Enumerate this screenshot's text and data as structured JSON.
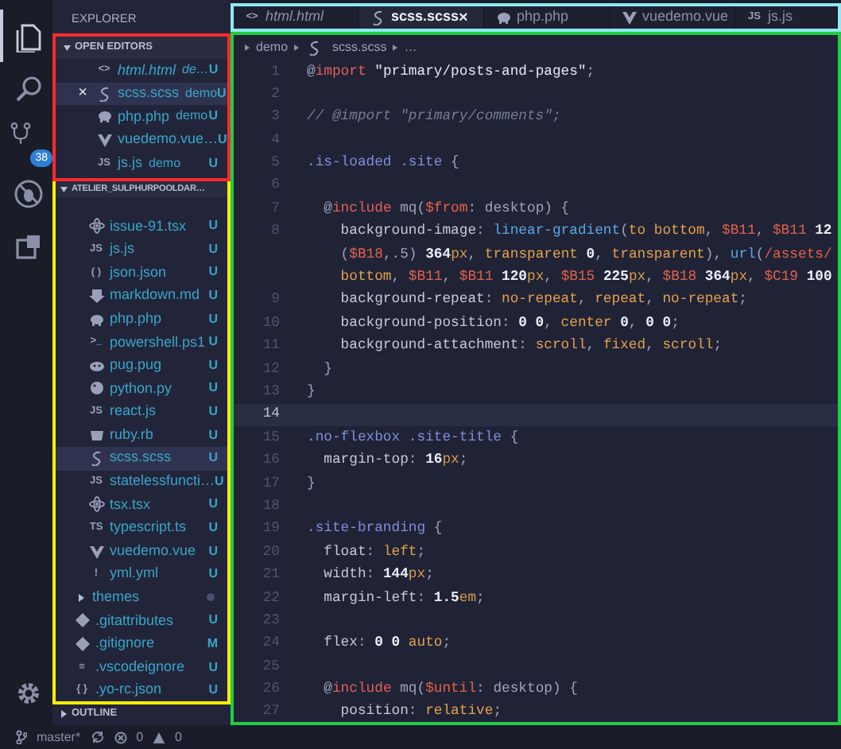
{
  "activity_bar": {
    "items": [
      {
        "kind": "files",
        "selected": true
      },
      {
        "kind": "search",
        "selected": false
      },
      {
        "kind": "source-control",
        "selected": false,
        "badge": "38"
      },
      {
        "kind": "debug",
        "selected": false
      },
      {
        "kind": "extensions",
        "selected": false
      }
    ],
    "bottom": {
      "kind": "settings"
    }
  },
  "sidebar": {
    "title": "EXPLORER",
    "open_editors": {
      "title": "OPEN EDITORS",
      "expanded": true,
      "items": [
        {
          "name": "html.html",
          "description": "de…",
          "kind": "text-icon",
          "glyph": "<>",
          "preview": true,
          "selected": false,
          "status": "U"
        },
        {
          "name": "scss.scss",
          "description": "demo",
          "kind": "scss",
          "preview": false,
          "selected": true,
          "close": "×",
          "status": "U"
        },
        {
          "name": "php.php",
          "description": "demo",
          "kind": "php",
          "preview": false,
          "selected": false,
          "status": "U"
        },
        {
          "name": "vuedemo.vue…",
          "kind": "vue",
          "preview": false,
          "selected": false,
          "status": "U"
        },
        {
          "name": "js.js",
          "description": "demo",
          "kind": "text-icon",
          "glyph": "JS",
          "preview": false,
          "selected": false,
          "status": "U"
        }
      ]
    },
    "project": {
      "title": "ATELIER_SULPHURPOOLDAR…",
      "expanded": true,
      "nested_files": [
        {
          "name": "issue-91.tsx",
          "kind": "tsx",
          "selected": false,
          "status": "U"
        },
        {
          "name": "js.js",
          "kind": "text-icon",
          "glyph": "JS",
          "selected": false,
          "status": "U"
        },
        {
          "name": "json.json",
          "kind": "text-icon",
          "glyph": "( )",
          "selected": false,
          "status": "U"
        },
        {
          "name": "markdown.md",
          "kind": "markdown",
          "selected": false,
          "status": "U"
        },
        {
          "name": "php.php",
          "kind": "php",
          "selected": false,
          "status": "U"
        },
        {
          "name": "powershell.ps1",
          "kind": "text-icon",
          "glyph": ">_",
          "selected": false,
          "status": "U"
        },
        {
          "name": "pug.pug",
          "kind": "pug",
          "selected": false,
          "status": "U"
        },
        {
          "name": "python.py",
          "kind": "python",
          "selected": false,
          "status": "U"
        },
        {
          "name": "react.js",
          "kind": "text-icon",
          "glyph": "JS",
          "selected": false,
          "status": "U"
        },
        {
          "name": "ruby.rb",
          "kind": "ruby",
          "selected": false,
          "status": "U"
        },
        {
          "name": "scss.scss",
          "kind": "scss",
          "selected": true,
          "status": "U"
        },
        {
          "name": "statelessfuncti…",
          "kind": "text-icon",
          "glyph": "JS",
          "selected": false,
          "status": "U"
        },
        {
          "name": "tsx.tsx",
          "kind": "tsx",
          "selected": false,
          "status": "U"
        },
        {
          "name": "typescript.ts",
          "kind": "text-icon",
          "glyph": "TS",
          "selected": false,
          "status": "U"
        },
        {
          "name": "vuedemo.vue",
          "kind": "vue",
          "selected": false,
          "status": "U"
        },
        {
          "name": "yml.yml",
          "kind": "text-icon",
          "glyph": "!",
          "selected": false,
          "status": "U"
        }
      ],
      "root_items": [
        {
          "kind": "folder",
          "name": "themes",
          "expanded": false,
          "dot": true,
          "selected": false
        },
        {
          "kind": "git",
          "name": ".gitattributes",
          "selected": false,
          "status": "U"
        },
        {
          "kind": "git",
          "name": ".gitignore",
          "selected": false,
          "status": "M"
        },
        {
          "kind": "text-icon",
          "glyph": "≡",
          "name": ".vscodeignore",
          "selected": false,
          "status": "U"
        },
        {
          "kind": "text-icon",
          "glyph": "{ }",
          "name": ".yo-rc.json",
          "selected": false,
          "status": "U"
        }
      ]
    },
    "outline": {
      "title": "OUTLINE",
      "expanded": false
    }
  },
  "tabs": [
    {
      "label": "html.html",
      "kind": "text-icon",
      "glyph": "<>",
      "preview": true,
      "selected": false
    },
    {
      "label": "scss.scss",
      "kind": "scss",
      "preview": false,
      "selected": true,
      "close": "×"
    },
    {
      "label": "php.php",
      "kind": "php",
      "preview": false,
      "selected": false
    },
    {
      "label": "vuedemo.vue",
      "kind": "vue",
      "preview": false,
      "selected": false
    },
    {
      "label": "js.js",
      "kind": "text-icon",
      "glyph": "JS",
      "preview": false,
      "selected": false
    }
  ],
  "editor": {
    "breadcrumbs": [
      {
        "label": "demo",
        "kind": "folder"
      },
      {
        "label": "scss.scss",
        "kind": "scss"
      },
      {
        "label": "…",
        "kind": "more"
      }
    ],
    "lines": [
      {
        "number": "1",
        "current": false,
        "tokens": [
          {
            "kind": "p",
            "text": "@"
          },
          {
            "kind": "kw",
            "text": "import"
          },
          {
            "kind": "str",
            "text": " \"primary/posts-and-pages\""
          },
          {
            "kind": "p",
            "text": ";"
          }
        ]
      },
      {
        "number": "2",
        "current": false
      },
      {
        "number": "3",
        "current": false,
        "tokens": [
          {
            "kind": "cm",
            "text": "// @import \"primary/comments\";"
          }
        ]
      },
      {
        "number": "4",
        "current": false
      },
      {
        "number": "5",
        "current": false,
        "tokens": [
          {
            "kind": "sel",
            "text": ".is-loaded .site"
          },
          {
            "kind": "p",
            "text": " {"
          }
        ]
      },
      {
        "number": "6",
        "current": false
      },
      {
        "number": "7",
        "current": false,
        "tokens": [
          {
            "kind": "p",
            "text": "  @"
          },
          {
            "kind": "kw",
            "text": "include"
          },
          {
            "kind": "p",
            "text": " mq("
          },
          {
            "kind": "var",
            "text": "$from"
          },
          {
            "kind": "p",
            "text": ": desktop) {"
          }
        ]
      },
      {
        "number": "8",
        "current": false,
        "tokens": [
          {
            "kind": "prop",
            "text": "    background-image"
          },
          {
            "kind": "p",
            "text": ": "
          },
          {
            "kind": "fn",
            "text": "linear-gradient"
          },
          {
            "kind": "p",
            "text": "("
          },
          {
            "kind": "val",
            "text": "to bottom"
          },
          {
            "kind": "p",
            "text": ", "
          },
          {
            "kind": "var",
            "text": "$B11"
          },
          {
            "kind": "p",
            "text": ", "
          },
          {
            "kind": "var",
            "text": "$B11"
          },
          {
            "kind": "num",
            "text": " 12"
          }
        ]
      },
      {
        "current": false,
        "tokens": [
          {
            "kind": "p",
            "text": "    ("
          },
          {
            "kind": "var",
            "text": "$B18"
          },
          {
            "kind": "p",
            "text": ",.5) "
          },
          {
            "kind": "num",
            "text": "364"
          },
          {
            "kind": "unit",
            "text": "px"
          },
          {
            "kind": "p",
            "text": ", "
          },
          {
            "kind": "val",
            "text": "transparent"
          },
          {
            "kind": "num",
            "text": " 0"
          },
          {
            "kind": "p",
            "text": ", "
          },
          {
            "kind": "val",
            "text": "transparent"
          },
          {
            "kind": "p",
            "text": "), "
          },
          {
            "kind": "fn",
            "text": "url"
          },
          {
            "kind": "p",
            "text": "("
          },
          {
            "kind": "var",
            "text": "/assets/"
          }
        ]
      },
      {
        "current": false,
        "tokens": [
          {
            "kind": "val",
            "text": "    bottom"
          },
          {
            "kind": "p",
            "text": ", "
          },
          {
            "kind": "var",
            "text": "$B11"
          },
          {
            "kind": "p",
            "text": ", "
          },
          {
            "kind": "var",
            "text": "$B11"
          },
          {
            "kind": "num",
            "text": " 120"
          },
          {
            "kind": "unit",
            "text": "px"
          },
          {
            "kind": "p",
            "text": ", "
          },
          {
            "kind": "var",
            "text": "$B15"
          },
          {
            "kind": "num",
            "text": " 225"
          },
          {
            "kind": "unit",
            "text": "px"
          },
          {
            "kind": "p",
            "text": ", "
          },
          {
            "kind": "var",
            "text": "$B18"
          },
          {
            "kind": "num",
            "text": " 364"
          },
          {
            "kind": "unit",
            "text": "px"
          },
          {
            "kind": "p",
            "text": ", "
          },
          {
            "kind": "var",
            "text": "$C19"
          },
          {
            "kind": "num",
            "text": " 100"
          }
        ]
      },
      {
        "number": "9",
        "current": false,
        "tokens": [
          {
            "kind": "prop",
            "text": "    background-repeat"
          },
          {
            "kind": "p",
            "text": ": "
          },
          {
            "kind": "val",
            "text": "no-repeat"
          },
          {
            "kind": "p",
            "text": ", "
          },
          {
            "kind": "val",
            "text": "repeat"
          },
          {
            "kind": "p",
            "text": ", "
          },
          {
            "kind": "val",
            "text": "no-repeat"
          },
          {
            "kind": "p",
            "text": ";"
          }
        ]
      },
      {
        "number": "10",
        "current": false,
        "tokens": [
          {
            "kind": "prop",
            "text": "    background-position"
          },
          {
            "kind": "p",
            "text": ": "
          },
          {
            "kind": "num",
            "text": "0 0"
          },
          {
            "kind": "p",
            "text": ", "
          },
          {
            "kind": "val",
            "text": "center"
          },
          {
            "kind": "num",
            "text": " 0"
          },
          {
            "kind": "p",
            "text": ", "
          },
          {
            "kind": "num",
            "text": "0 0"
          },
          {
            "kind": "p",
            "text": ";"
          }
        ]
      },
      {
        "number": "11",
        "current": false,
        "tokens": [
          {
            "kind": "prop",
            "text": "    background-attachment"
          },
          {
            "kind": "p",
            "text": ": "
          },
          {
            "kind": "val",
            "text": "scroll"
          },
          {
            "kind": "p",
            "text": ", "
          },
          {
            "kind": "val",
            "text": "fixed"
          },
          {
            "kind": "p",
            "text": ", "
          },
          {
            "kind": "val",
            "text": "scroll"
          },
          {
            "kind": "p",
            "text": ";"
          }
        ]
      },
      {
        "number": "12",
        "current": false,
        "tokens": [
          {
            "kind": "p",
            "text": "  }"
          }
        ]
      },
      {
        "number": "13",
        "current": false,
        "tokens": [
          {
            "kind": "p",
            "text": "}"
          }
        ]
      },
      {
        "number": "14",
        "current": true
      },
      {
        "number": "15",
        "current": false,
        "tokens": [
          {
            "kind": "sel",
            "text": ".no-flexbox .site-title"
          },
          {
            "kind": "p",
            "text": " {"
          }
        ]
      },
      {
        "number": "16",
        "current": false,
        "tokens": [
          {
            "kind": "prop",
            "text": "  margin-top"
          },
          {
            "kind": "p",
            "text": ": "
          },
          {
            "kind": "num",
            "text": "16"
          },
          {
            "kind": "unit",
            "text": "px"
          },
          {
            "kind": "p",
            "text": ";"
          }
        ]
      },
      {
        "number": "17",
        "current": false,
        "tokens": [
          {
            "kind": "p",
            "text": "}"
          }
        ]
      },
      {
        "number": "18",
        "current": false
      },
      {
        "number": "19",
        "current": false,
        "tokens": [
          {
            "kind": "sel",
            "text": ".site-branding"
          },
          {
            "kind": "p",
            "text": " {"
          }
        ]
      },
      {
        "number": "20",
        "current": false,
        "tokens": [
          {
            "kind": "prop",
            "text": "  float"
          },
          {
            "kind": "p",
            "text": ": "
          },
          {
            "kind": "val",
            "text": "left"
          },
          {
            "kind": "p",
            "text": ";"
          }
        ]
      },
      {
        "number": "21",
        "current": false,
        "tokens": [
          {
            "kind": "prop",
            "text": "  width"
          },
          {
            "kind": "p",
            "text": ": "
          },
          {
            "kind": "num",
            "text": "144"
          },
          {
            "kind": "unit",
            "text": "px"
          },
          {
            "kind": "p",
            "text": ";"
          }
        ]
      },
      {
        "number": "22",
        "current": false,
        "tokens": [
          {
            "kind": "prop",
            "text": "  margin-left"
          },
          {
            "kind": "p",
            "text": ": "
          },
          {
            "kind": "num",
            "text": "1.5"
          },
          {
            "kind": "unit",
            "text": "em"
          },
          {
            "kind": "p",
            "text": ";"
          }
        ]
      },
      {
        "number": "23",
        "current": false
      },
      {
        "number": "24",
        "current": false,
        "tokens": [
          {
            "kind": "prop",
            "text": "  flex"
          },
          {
            "kind": "p",
            "text": ": "
          },
          {
            "kind": "num",
            "text": "0 0"
          },
          {
            "kind": "val",
            "text": " auto"
          },
          {
            "kind": "p",
            "text": ";"
          }
        ]
      },
      {
        "number": "25",
        "current": false
      },
      {
        "number": "26",
        "current": false,
        "tokens": [
          {
            "kind": "p",
            "text": "  @"
          },
          {
            "kind": "kw",
            "text": "include"
          },
          {
            "kind": "p",
            "text": " mq("
          },
          {
            "kind": "var",
            "text": "$until"
          },
          {
            "kind": "p",
            "text": ": desktop) {"
          }
        ]
      },
      {
        "number": "27",
        "current": false,
        "tokens": [
          {
            "kind": "prop",
            "text": "    position"
          },
          {
            "kind": "p",
            "text": ": "
          },
          {
            "kind": "val",
            "text": "relative"
          },
          {
            "kind": "p",
            "text": ";"
          }
        ]
      }
    ]
  },
  "status_bar": {
    "branch": "master*",
    "errors": "0",
    "warnings": "0"
  }
}
